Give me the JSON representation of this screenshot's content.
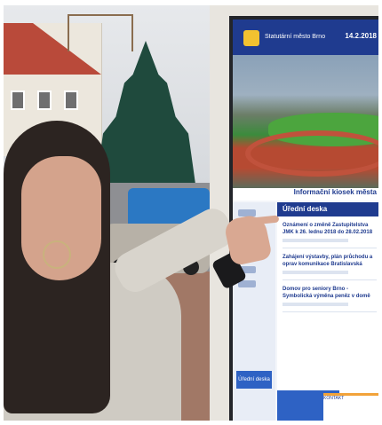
{
  "kiosk": {
    "city_name": "Statutární město Brno",
    "date": "14.2.2018",
    "title": "Informační kiosek města",
    "section_title": "Úřední deska",
    "items": [
      {
        "title": "Oznámení o změně Zastupitelstva JMK k 26. lednu 2018 do 28.02.2018"
      },
      {
        "title": "Zahájení výstavby, plán průchodu a oprav komunikace Bratislavská"
      },
      {
        "title": "Domov pro seniory Brno - Symbolická výměna peněz v domě"
      }
    ],
    "nav_button_label": "Úřední deska",
    "bottom_card_text": "KONTAKT"
  },
  "colors": {
    "kiosk_blue": "#1f3b8f",
    "button_blue": "#2e62c4",
    "accent_orange": "#f2a33a"
  }
}
